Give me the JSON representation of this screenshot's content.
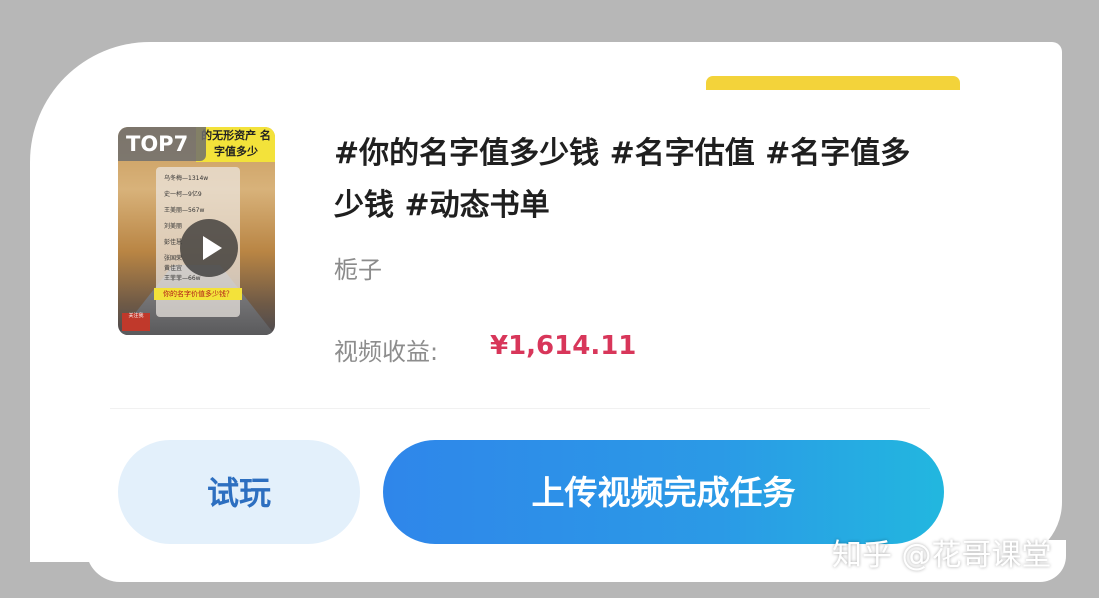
{
  "thumbnail": {
    "badge": "TOP7",
    "banner": "的无形资产 名字值多少",
    "lines": [
      "乌冬梅—1314w",
      "史一柯—9亿9",
      "王美丽—567w",
      "刘美丽",
      "彭佳慧",
      "张国荣",
      "黄佳宜",
      "王菲菲—66w"
    ],
    "footer": "你的名字价值多少钱？",
    "stamp": "关注我",
    "play_icon": "play-icon"
  },
  "video": {
    "title": "#你的名字值多少钱 #名字估值 #名字值多少钱 #动态书单",
    "author": "栀子",
    "earnings_label": "视频收益:",
    "earnings_value": "¥1,614.11"
  },
  "actions": {
    "try_label": "试玩",
    "upload_label": "上传视频完成任务"
  },
  "watermark": "知乎 @花哥课堂",
  "colors": {
    "accent_blue": "#2f86ea",
    "earnings_red": "#d8365a",
    "try_bg": "#e3f0fb",
    "yellow": "#f3d33a"
  }
}
